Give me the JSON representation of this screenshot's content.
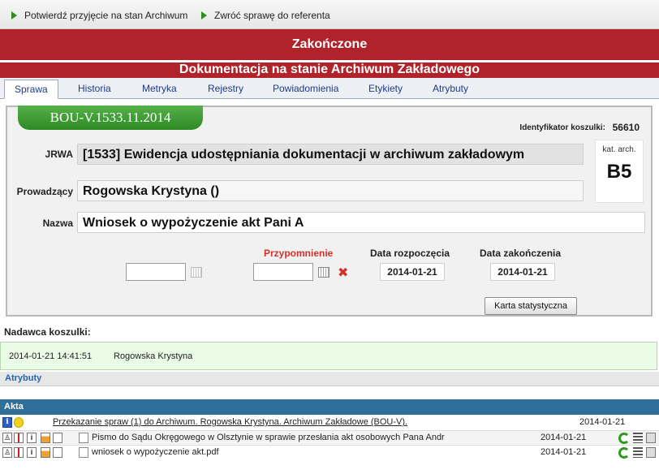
{
  "toolbar": {
    "confirm_label": "Potwierdź przyjęcie na stan Archiwum",
    "return_label": "Zwróć sprawę do referenta"
  },
  "status": {
    "title": "Zakończone"
  },
  "subtitle": "Dokumentacja na stanie Archiwum Zakładowego",
  "tabs": [
    {
      "label": "Sprawa",
      "active": true
    },
    {
      "label": "Historia"
    },
    {
      "label": "Metryka"
    },
    {
      "label": "Rejestry"
    },
    {
      "label": "Powiadomienia"
    },
    {
      "label": "Etykiety"
    },
    {
      "label": "Atrybuty"
    }
  ],
  "case": {
    "signature": "BOU-V.1533.11.2014",
    "id_label": "Identyfikator koszulki:",
    "id_value": "56610",
    "jrwa_label": "JRWA",
    "jrwa_value": "[1533] Ewidencja udostępniania dokumentacji w archiwum zakładowym",
    "owner_label": "Prowadzący",
    "owner_value": "Rogowska Krystyna ()",
    "name_label": "Nazwa",
    "name_value": "Wniosek o wypożyczenie akt Pani A",
    "kat_label": "kat. arch.",
    "kat_value": "B5",
    "reminder_label": "Przypomnienie",
    "start_label": "Data rozpoczęcia",
    "start_value": "2014-01-21",
    "end_label": "Data zakończenia",
    "end_value": "2014-01-21",
    "stats_button": "Karta statystyczna"
  },
  "sender": {
    "label": "Nadawca koszulki:",
    "datetime": "2014-01-21 14:41:51",
    "name": "Rogowska Krystyna"
  },
  "attributes_label": "Atrybuty",
  "akta": {
    "label": "Akta",
    "main": {
      "text": "Przekazanie spraw (1) do Archiwum. Rogowska Krystyna. Archiwum Zakładowe (BOU-V).",
      "date": "2014-01-21"
    },
    "rows": [
      {
        "text": "Pismo do Sądu Okręgowego w Olsztynie w sprawie przesłania akt osobowych Pana Andr",
        "date": "2014-01-21"
      },
      {
        "text": "wniosek o wypożyczenie akt.pdf",
        "date": "2014-01-21"
      }
    ]
  },
  "colors": {
    "status_red": "#b0232a",
    "ribbon_green": "#3b9a30",
    "akta_blue": "#2f6f99",
    "reminder_red": "#d0312d"
  }
}
